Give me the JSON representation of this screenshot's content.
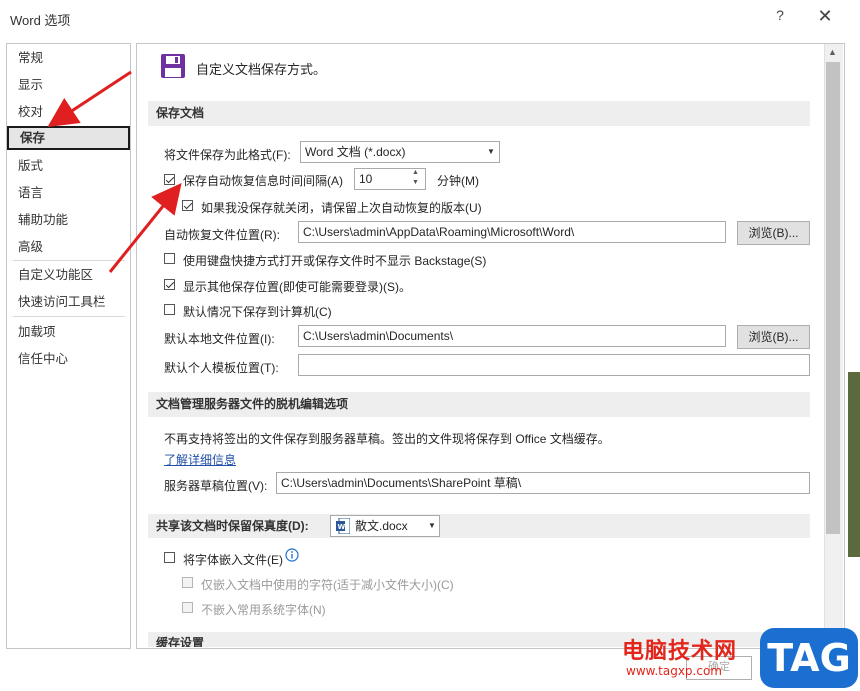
{
  "window": {
    "title": "Word 选项",
    "help": "?",
    "close": "✕"
  },
  "sidebar": {
    "items": [
      {
        "label": "常规"
      },
      {
        "label": "显示"
      },
      {
        "label": "校对"
      },
      {
        "label": "保存"
      },
      {
        "label": "版式"
      },
      {
        "label": "语言"
      },
      {
        "label": "辅助功能"
      },
      {
        "label": "高级"
      },
      {
        "label": "自定义功能区"
      },
      {
        "label": "快速访问工具栏"
      },
      {
        "label": "加载项"
      },
      {
        "label": "信任中心"
      }
    ],
    "selected": "保存"
  },
  "main": {
    "header": "自定义文档保存方式。",
    "save_section": {
      "title": "保存文档",
      "format_label": "将文件保存为此格式(F):",
      "format_value": "Word 文档 (*.docx)",
      "autorecover_label": "保存自动恢复信息时间间隔(A)",
      "autorecover_checked": true,
      "autorecover_value": "10",
      "minutes_label": "分钟(M)",
      "keep_last_label": "如果我没保存就关闭，请保留上次自动恢复的版本(U)",
      "keep_last_checked": true,
      "autorecover_location_label": "自动恢复文件位置(R):",
      "autorecover_location_value": "C:\\Users\\admin\\AppData\\Roaming\\Microsoft\\Word\\",
      "browse1": "浏览(B)...",
      "no_backstage_label": "使用键盘快捷方式打开或保存文件时不显示 Backstage(S)",
      "no_backstage_checked": false,
      "show_other_label": "显示其他保存位置(即使可能需要登录)(S)。",
      "show_other_checked": true,
      "save_to_computer_label": "默认情况下保存到计算机(C)",
      "save_to_computer_checked": false,
      "local_location_label": "默认本地文件位置(I):",
      "local_location_value": "C:\\Users\\admin\\Documents\\",
      "browse2": "浏览(B)...",
      "template_location_label": "默认个人模板位置(T):",
      "template_location_value": ""
    },
    "offline_section": {
      "title": "文档管理服务器文件的脱机编辑选项",
      "info": "不再支持将签出的文件保存到服务器草稿。签出的文件现将保存到 Office 文档缓存。",
      "learn_more": "了解详细信息",
      "drafts_label": "服务器草稿位置(V):",
      "drafts_value": "C:\\Users\\admin\\Documents\\SharePoint 草稿\\"
    },
    "fidelity_section": {
      "title": "共享该文档时保留保真度(D):",
      "doc_value": "散文.docx",
      "embed_fonts_label": "将字体嵌入文件(E)",
      "embed_fonts_checked": false,
      "embed_used_label": "仅嵌入文档中使用的字符(适于减小文件大小)(C)",
      "no_common_label": "不嵌入常用系统字体(N)"
    },
    "cache_section": {
      "title": "缓存设置"
    }
  },
  "footer": {
    "ok": "确定"
  },
  "watermark": {
    "text": "电脑技术网",
    "url": "www.tagxp.com",
    "tag": "TAG"
  },
  "colors": {
    "arrow": "#e02020",
    "accent": "#7030a0",
    "link": "#1f4fa6"
  },
  "icons": {
    "save": "floppy-disk-icon",
    "info": "info-icon",
    "word_doc": "word-doc-icon"
  }
}
